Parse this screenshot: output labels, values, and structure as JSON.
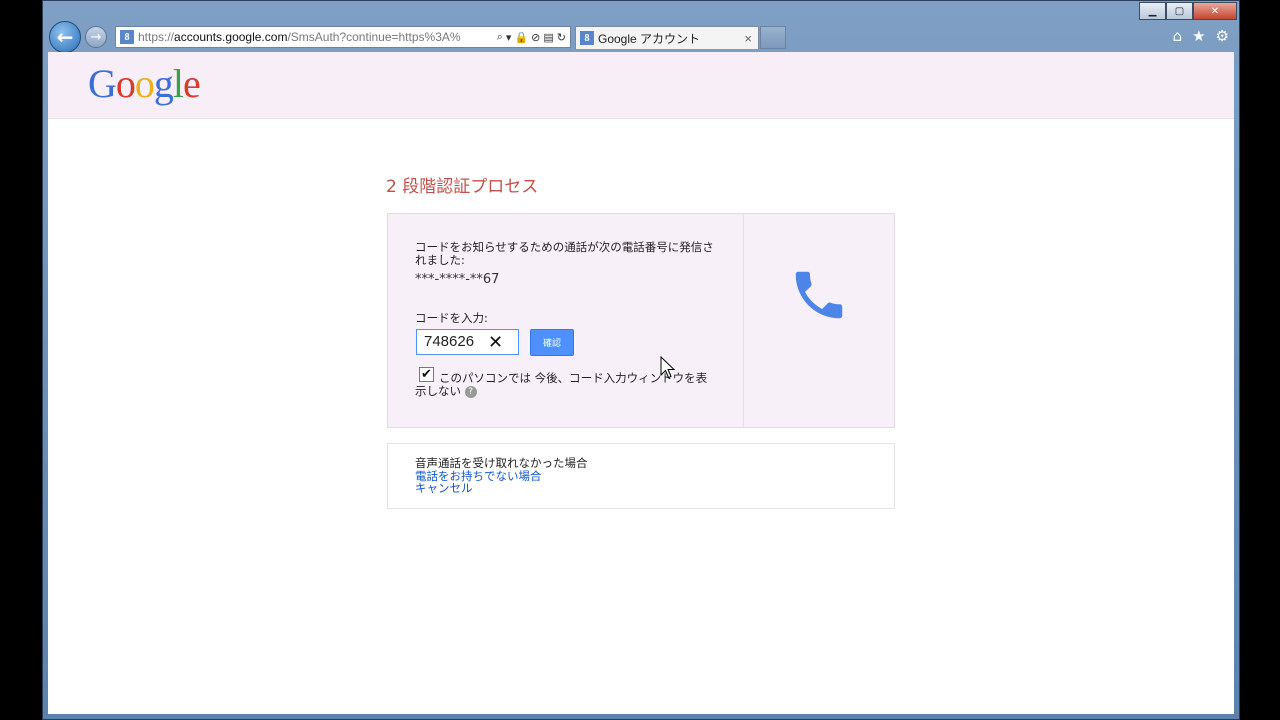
{
  "browser": {
    "url_prefix": "https://",
    "url_host": "accounts.google.com",
    "url_path": "/SmsAuth?continue=https%3A%",
    "tab_title": "Google アカウント",
    "tab_close": "×",
    "favicon_letter": "8"
  },
  "header": {
    "logo": "Google"
  },
  "page": {
    "title": "2 段階認証プロセス"
  },
  "verify": {
    "message": "コードをお知らせするための通話が次の電話番号に発信されました:",
    "phone_number": "***-****-**67",
    "code_label": "コードを入力:",
    "code_value": "748626",
    "verify_button": "確認",
    "remember_text": "このパソコンでは 今後、コード入力ウィンドウを表示しない",
    "help": "?"
  },
  "alternatives": {
    "text": "音声通話を受け取れなかった場合",
    "link_no_phone": "電話をお持ちでない場合",
    "link_cancel": "キャンセル"
  },
  "colors": {
    "accent": "#4d90fe",
    "title": "#c2504a",
    "header_bg": "#f7eef7"
  }
}
